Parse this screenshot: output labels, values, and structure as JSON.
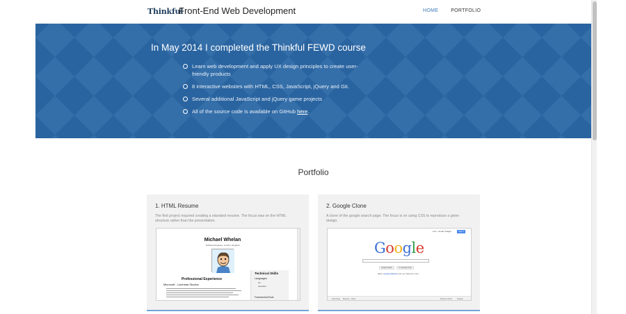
{
  "header": {
    "logo": "Thinkful",
    "site_title": "Front-End Web Development",
    "nav": [
      {
        "label": "HOME",
        "active": true
      },
      {
        "label": "PORTFOLIO",
        "active": false
      }
    ]
  },
  "hero": {
    "title": "In May 2014 I completed the Thinkful FEWD course",
    "items": [
      "Learn web development and apply UX design principles to create user-friendly products",
      "8 interactive websites with HTML, CSS, JavaScript, jQuery and Git.",
      "Several additional JavaScript and jQuery game projects",
      "All of the source code is available on GitHub"
    ],
    "github_link": "here",
    "github_period": ".",
    "background_color": "#2f6ea9"
  },
  "portfolio": {
    "title": "Portfolio",
    "cards": [
      {
        "title": "1. HTML Resume",
        "description": "The first project required creating a standard resume. The focus was on the HTML structure rather than the presentation.",
        "thumbnail": {
          "name": "Michael Whelan",
          "subtitle": "Software Engineer, London, England",
          "experience_heading": "Professional Experience",
          "job": "Microsoft - Lionhead Studios",
          "skills_heading": "Technical Skills",
          "languages_label": "Languages",
          "languages": [
            "C#",
            "Java/Java"
          ],
          "frameworks_label": "Frameworks/Tools"
        }
      },
      {
        "title": "2. Google Clone",
        "description": "A clone of the google search page. The focus is on using CSS to reproduce a given design.",
        "thumbnail": {
          "top_links": [
            "+You",
            "Gmail",
            "Images"
          ],
          "sign_in": "Sign in",
          "logo_letters": [
            "G",
            "o",
            "o",
            "g",
            "l",
            "e"
          ],
          "logo_colors": [
            "#3b6fd6",
            "#d93a2e",
            "#f2b01e",
            "#3b6fd6",
            "#2c9b44",
            "#d93a2e"
          ],
          "buttons": [
            "Google Search",
            "I'm Feeling Lucky"
          ],
          "note_prefix": "Make a",
          "note_link": "special Valentine",
          "note_suffix": "with your Valentine's story",
          "footer_left": [
            "Advertising",
            "Business",
            "About"
          ],
          "footer_right": [
            "Privacy & Terms",
            "Settings"
          ]
        }
      }
    ]
  },
  "colors": {
    "accent": "#3a78b8",
    "card_border": "#6fa3d8",
    "card_bg": "#f1f1f1"
  }
}
